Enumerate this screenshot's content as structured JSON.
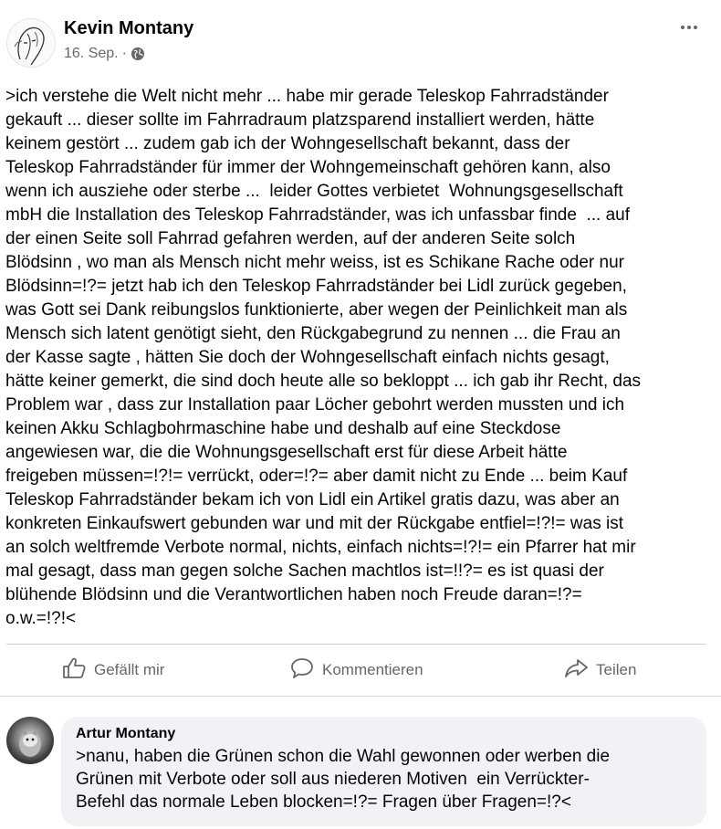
{
  "post": {
    "author": "Kevin Montany",
    "date": "16. Sep.",
    "separator": "·",
    "privacy_icon": "globe-icon",
    "more_icon": "more-options-icon",
    "text": ">ich verstehe die Welt nicht mehr ... habe mir gerade Teleskop Fahrradständer\ngekauft ... dieser sollte im Fahrradraum platzsparend installiert werden, hätte\nkeinem gestört ... zudem gab ich der Wohngesellschaft bekannt, dass der\nTeleskop Fahrradständer für immer der Wohngemeinschaft gehören kann, also\nwenn ich ausziehe oder sterbe ...  leider Gottes verbietet  Wohnungsgesellschaft\nmbH die Installation des Teleskop Fahrradständer, was ich unfassbar finde  ... auf\nder einen Seite soll Fahrrad gefahren werden, auf der anderen Seite solch\nBlödsinn , wo man als Mensch nicht mehr weiss, ist es Schikane Rache oder nur\nBlödsinn=!?= jetzt hab ich den Teleskop Fahrradständer bei Lidl zurück gegeben,\nwas Gott sei Dank reibungslos funktionierte, aber wegen der Peinlichkeit man als\nMensch sich latent genötigt sieht, den Rückgabegrund zu nennen ... die Frau an\nder Kasse sagte , hätten Sie doch der Wohngesellschaft einfach nichts gesagt,\nhätte keiner gemerkt, die sind doch heute alle so bekloppt ... ich gab ihr Recht, das\nProblem war , dass zur Installation paar Löcher gebohrt werden mussten und ich\nkeinen Akku Schlagbohrmaschine habe und deshalb auf eine Steckdose\nangewiesen war, die die Wohnungsgesellschaft erst für diese Arbeit hätte\nfreigeben müssen=!?!= verrückt, oder=!?= aber damit nicht zu Ende ... beim Kauf\nTeleskop Fahrradständer bekam ich von Lidl ein Artikel gratis dazu, was aber an\nkonkreten Einkaufswert gebunden war und mit der Rückgabe entfiel=!?!= was ist\nan solch weltfremde Verbote normal, nichts, einfach nichts=!?!= ein Pfarrer hat mir\nmal gesagt, dass man gegen solche Sachen machtlos ist=!!?= es ist quasi der\nblühende Blödsinn und die Verantwortlichen haben noch Freude daran=!?=\no.w.=!?!<"
  },
  "actions": {
    "like": {
      "label": "Gefällt mir",
      "icon": "thumbs-up-icon"
    },
    "comment": {
      "label": "Kommentieren",
      "icon": "comment-icon"
    },
    "share": {
      "label": "Teilen",
      "icon": "share-icon"
    }
  },
  "comments": [
    {
      "author": "Artur Montany",
      "text": ">nanu, haben die Grünen schon die Wahl gewonnen oder werben die\nGrünen mit Verbote oder soll aus niederen Motiven  ein Verrückter-\nBefehl das normale Leben blocken=!?= Fragen über Fragen=!?<"
    }
  ],
  "colors": {
    "text_primary": "#050505",
    "text_secondary": "#65676b",
    "comment_bubble": "#f0f2f5",
    "divider": "#ced0d4"
  }
}
